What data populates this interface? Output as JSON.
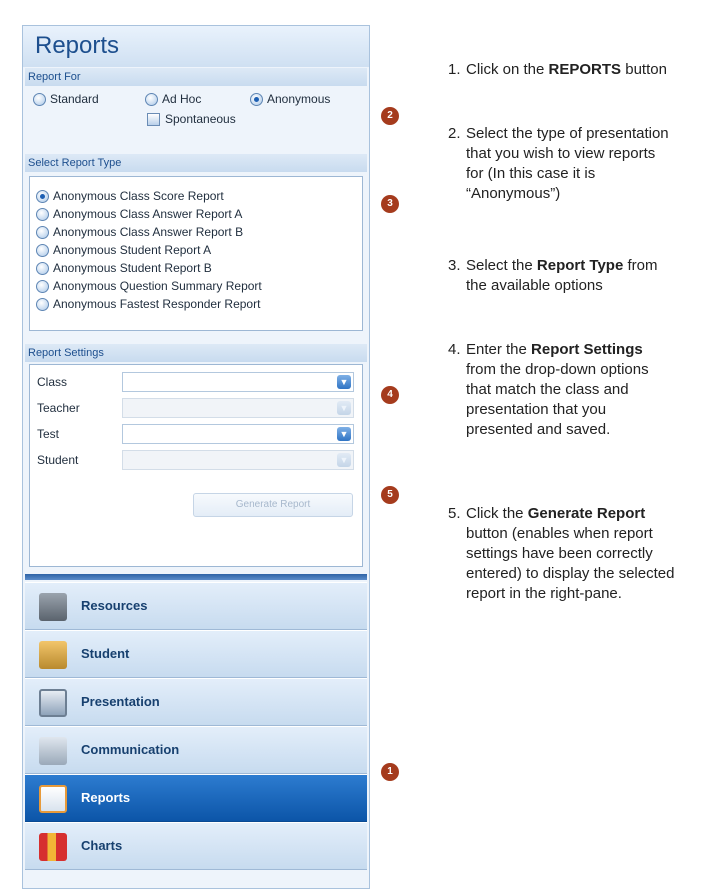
{
  "panel": {
    "title": "Reports",
    "report_for": {
      "header": "Report For",
      "options": [
        {
          "label": "Standard",
          "selected": false
        },
        {
          "label": "Ad Hoc",
          "selected": false
        },
        {
          "label": "Anonymous",
          "selected": true
        }
      ],
      "checkbox_label": "Spontaneous"
    },
    "select_report_type": {
      "header": "Select Report Type",
      "items": [
        {
          "label": "Anonymous Class Score Report",
          "selected": true
        },
        {
          "label": "Anonymous Class Answer Report A",
          "selected": false
        },
        {
          "label": "Anonymous Class Answer Report B",
          "selected": false
        },
        {
          "label": "Anonymous Student Report A",
          "selected": false
        },
        {
          "label": "Anonymous Student Report B",
          "selected": false
        },
        {
          "label": "Anonymous Question Summary Report",
          "selected": false
        },
        {
          "label": "Anonymous Fastest Responder Report",
          "selected": false
        }
      ]
    },
    "report_settings": {
      "header": "Report Settings",
      "fields": [
        {
          "label": "Class",
          "value": "",
          "enabled": true
        },
        {
          "label": "Teacher",
          "value": "",
          "enabled": false
        },
        {
          "label": "Test",
          "value": "",
          "enabled": true
        },
        {
          "label": "Student",
          "value": "",
          "enabled": false
        }
      ],
      "generate_button": "Generate Report"
    },
    "nav": [
      {
        "label": "Resources",
        "icon": "resources-icon",
        "active": false
      },
      {
        "label": "Student",
        "icon": "student-icon",
        "active": false
      },
      {
        "label": "Presentation",
        "icon": "presentation-icon",
        "active": false
      },
      {
        "label": "Communication",
        "icon": "communication-icon",
        "active": false
      },
      {
        "label": "Reports",
        "icon": "reports-icon",
        "active": true
      },
      {
        "label": "Charts",
        "icon": "charts-icon",
        "active": false
      }
    ]
  },
  "badges": [
    "2",
    "3",
    "4",
    "5",
    "1"
  ],
  "steps": [
    {
      "num": "1.",
      "pre": "Click on the ",
      "bold": "REPORTS",
      "post": " button"
    },
    {
      "num": "2.",
      "pre": "Select the type of presentation that you wish to view reports for (In this case it is “Anonymous”)",
      "bold": "",
      "post": ""
    },
    {
      "num": "3.",
      "pre": "Select the ",
      "bold": "Report Type",
      "post": " from the available options"
    },
    {
      "num": "4.",
      "pre": "Enter the ",
      "bold": "Report Settings",
      "post": " from the drop-down options that match the class and presentation that you presented and saved."
    },
    {
      "num": "5.",
      "pre": "Click the ",
      "bold": "Generate Report",
      "post": " button (enables when report settings have been correctly entered) to display the selected report in the right-pane."
    }
  ],
  "colors": {
    "accent": "#1d4f8e",
    "active_nav": "#0c55a8",
    "badge": "#a53b1d"
  }
}
